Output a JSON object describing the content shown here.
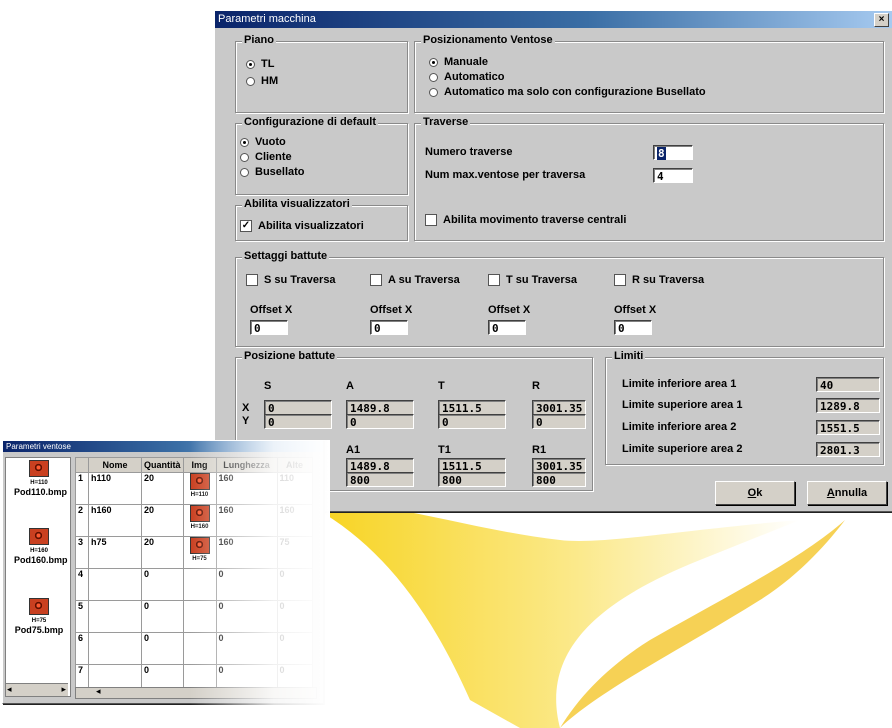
{
  "main_window": {
    "title": "Parametri macchina",
    "close": "×"
  },
  "piano": {
    "legend": "Piano",
    "options": [
      {
        "label": "TL",
        "selected": true
      },
      {
        "label": "HM",
        "selected": false
      }
    ]
  },
  "posizionamento": {
    "legend": "Posizionamento Ventose",
    "options": [
      {
        "label": "Manuale",
        "selected": true
      },
      {
        "label": "Automatico",
        "selected": false
      },
      {
        "label": "Automatico ma solo con configurazione Busellato",
        "selected": false
      }
    ]
  },
  "configurazione": {
    "legend": "Configurazione di default",
    "options": [
      {
        "label": "Vuoto",
        "selected": true
      },
      {
        "label": "Cliente",
        "selected": false
      },
      {
        "label": "Busellato",
        "selected": false
      }
    ]
  },
  "traverse": {
    "legend": "Traverse",
    "numero_label": "Numero traverse",
    "numero_value": "8",
    "max_label": "Num max.ventose per traversa",
    "max_value": "4",
    "movimento_label": "Abilita movimento traverse centrali"
  },
  "abilita": {
    "legend": "Abilita visualizzatori",
    "check_label": "Abilita visualizzatori",
    "checked": true
  },
  "settaggi": {
    "legend": "Settaggi battute",
    "items": [
      {
        "label": "S su Traversa",
        "offset_label": "Offset X",
        "offset": "0"
      },
      {
        "label": "A su Traversa",
        "offset_label": "Offset X",
        "offset": "0"
      },
      {
        "label": "T su Traversa",
        "offset_label": "Offset X",
        "offset": "0"
      },
      {
        "label": "R su Traversa",
        "offset_label": "Offset X",
        "offset": "0"
      }
    ]
  },
  "posizione": {
    "legend": "Posizione battute",
    "x_label": "X",
    "y_label": "Y",
    "headers1": [
      "S",
      "A",
      "T",
      "R"
    ],
    "row_x": [
      "0",
      "1489.8",
      "1511.5",
      "3001.35"
    ],
    "row_y": [
      "0",
      "0",
      "0",
      "0"
    ],
    "headers2": [
      "A1",
      "T1",
      "R1"
    ],
    "row_x2": [
      "1489.8",
      "1511.5",
      "3001.35"
    ],
    "row_y2": [
      "800",
      "800",
      "800"
    ]
  },
  "limiti": {
    "legend": "Limiti",
    "rows": [
      {
        "label": "Limite inferiore area 1",
        "value": "40"
      },
      {
        "label": "Limite superiore area 1",
        "value": "1289.8"
      },
      {
        "label": "Limite inferiore area 2",
        "value": "1551.5"
      },
      {
        "label": "Limite superiore area 2",
        "value": "2801.3"
      }
    ]
  },
  "buttons": {
    "ok_u": "O",
    "ok_rest": "k",
    "annulla_u": "A",
    "annulla_rest": "nnulla"
  },
  "ventose_window": {
    "title": "Parametri ventose",
    "pods": [
      {
        "tag": "H=110",
        "file": "Pod110.bmp"
      },
      {
        "tag": "H=160",
        "file": "Pod160.bmp"
      },
      {
        "tag": "H=75",
        "file": "Pod75.bmp"
      }
    ],
    "scroll_left": "◂",
    "scroll_right": "▸",
    "columns": [
      "",
      "Nome",
      "Quantità",
      "Img",
      "Lunghezza",
      "Alte"
    ],
    "rows": [
      {
        "n": "1",
        "nome": "h110",
        "qta": "20",
        "img": "H=110",
        "lung": "160",
        "alt": "110"
      },
      {
        "n": "2",
        "nome": "h160",
        "qta": "20",
        "img": "H=160",
        "lung": "160",
        "alt": "160"
      },
      {
        "n": "3",
        "nome": "h75",
        "qta": "20",
        "img": "H=75",
        "lung": "160",
        "alt": "75"
      },
      {
        "n": "4",
        "nome": "",
        "qta": "0",
        "img": "",
        "lung": "0",
        "alt": "0"
      },
      {
        "n": "5",
        "nome": "",
        "qta": "0",
        "img": "",
        "lung": "0",
        "alt": "0"
      },
      {
        "n": "6",
        "nome": "",
        "qta": "0",
        "img": "",
        "lung": "0",
        "alt": "0"
      },
      {
        "n": "7",
        "nome": "",
        "qta": "0",
        "img": "",
        "lung": "0",
        "alt": "0"
      }
    ]
  }
}
